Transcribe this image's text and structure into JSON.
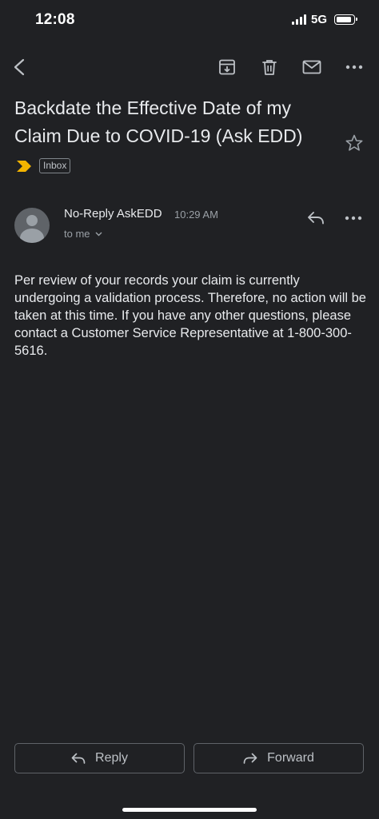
{
  "status_bar": {
    "time": "12:08",
    "network": "5G",
    "icons": [
      "signal-icon",
      "battery-icon"
    ]
  },
  "toolbar": {
    "icons": [
      "back-arrow-icon",
      "archive-icon",
      "trash-icon",
      "mail-icon",
      "more-icon"
    ]
  },
  "email": {
    "subject": "Backdate the Effective Date of my Claim Due to COVID-19 (Ask EDD)",
    "label": "Inbox",
    "importance_color": "#f4b400",
    "sender": "No-Reply AskEDD",
    "time": "10:29 AM",
    "recipient": "to me",
    "body": "Per review of your records your claim is currently undergoing a validation process. Therefore, no action will be taken at this time. If you have any other questions, please contact a Customer Service Representative at 1-800-300-5616."
  },
  "actions": {
    "reply_label": "Reply",
    "forward_label": "Forward"
  },
  "colors": {
    "background": "#202124",
    "text": "#e8eaed",
    "secondary_text": "#9aa0a6",
    "border": "#5f6368"
  }
}
